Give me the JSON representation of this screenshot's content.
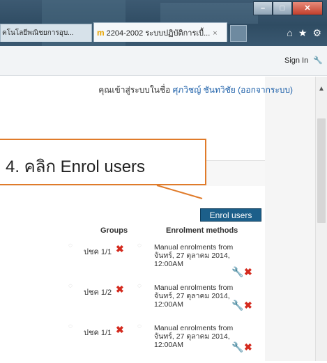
{
  "browser": {
    "tab1_title": "คโนโลยีพณิชยการอุบ...",
    "tab2_title": "2204-2002 ระบบปฏิบัติการเบื้...",
    "tab2_favicon": "m",
    "tab_close": "×",
    "signin_label": "Sign In"
  },
  "login": {
    "prefix": "คุณเข้าสู่ระบบในชื่อ",
    "user_name": "ศุภวิชญ์ ชันทวิชัย",
    "logout_label": "(ออกจากระบบ)"
  },
  "callout": {
    "text": "4. คลิก Enrol users"
  },
  "enrol_button": "Enrol users",
  "table": {
    "headers": {
      "groups": "Groups",
      "methods": "Enrolment methods"
    },
    "rows": [
      {
        "group": "ปชค 1/1",
        "method": "Manual enrolments from จันทร์, 27 ตุลาคม 2014, 12:00AM"
      },
      {
        "group": "ปชค 1/2",
        "method": "Manual enrolments from จันทร์, 27 ตุลาคม 2014, 12:00AM"
      },
      {
        "group": "ปชค 1/1",
        "method": "Manual enrolments from จันทร์, 27 ตุลาคม 2014, 12:00AM"
      }
    ]
  },
  "colors": {
    "accent_orange": "#e07b2a",
    "button_blue": "#1c5f8a",
    "delete_red": "#d42a1e",
    "link_blue": "#1a5ea8"
  }
}
